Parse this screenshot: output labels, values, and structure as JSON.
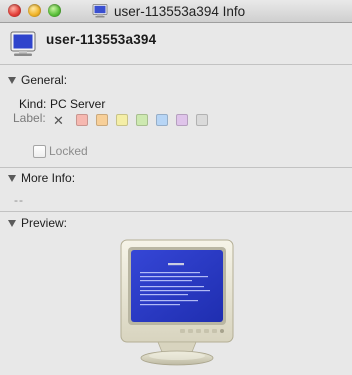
{
  "window": {
    "title": "user-113553a394 Info"
  },
  "header": {
    "name": "user-113553a394"
  },
  "general": {
    "heading": "General:",
    "kind_label": "Kind:",
    "kind_value": "PC Server",
    "label_label": "Label:",
    "label_colors": [
      "#f6b8b0",
      "#f7cf98",
      "#f4eea6",
      "#cde9b0",
      "#b7d5f5",
      "#dfc4ea",
      "#dadada"
    ],
    "locked_label": "Locked"
  },
  "more_info": {
    "heading": "More Info:",
    "value": "--"
  },
  "preview": {
    "heading": "Preview:"
  },
  "icons": {
    "title": "pc-monitor-icon",
    "header": "pc-monitor-icon",
    "preview": "crt-monitor-bsod-preview"
  },
  "colors": {
    "screen_blue": "#2a39c8",
    "bezel": "#e9e6d6"
  }
}
